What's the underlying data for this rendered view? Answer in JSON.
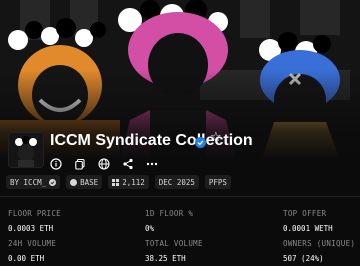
{
  "collection": {
    "name": "ICCM Syndicate Collection",
    "verified_icon": "verified-badge-icon",
    "favorite_icon": "star-icon"
  },
  "actions": [
    {
      "name": "info-icon"
    },
    {
      "name": "copy-icon"
    },
    {
      "name": "globe-icon"
    },
    {
      "name": "share-icon"
    },
    {
      "name": "more-icon"
    }
  ],
  "tags": {
    "creator": "BY ICCM_",
    "chain": "BASE",
    "items": "2,112",
    "date": "DEC 2025",
    "category": "PFPS"
  },
  "stats": {
    "floor_price_label": "FLOOR PRICE",
    "floor_price_value": "0.0003 ETH",
    "floor_change_label": "1D FLOOR %",
    "floor_change_value": "0%",
    "top_offer_label": "TOP OFFER",
    "top_offer_value": "0.0001 WETH",
    "volume_24h_label": "24H VOLUME",
    "volume_24h_value": "0.00 ETH",
    "total_volume_label": "TOTAL VOLUME",
    "total_volume_value": "38.25 ETH",
    "owners_label": "OWNERS (UNIQUE)",
    "owners_value": "507 (24%)"
  },
  "colors": {
    "background": "#0b0b0b",
    "accent_blue": "#2081e2",
    "banner_orange": "#e08a2c",
    "banner_pink": "#d24fa5",
    "banner_blue": "#3a6fd8"
  }
}
